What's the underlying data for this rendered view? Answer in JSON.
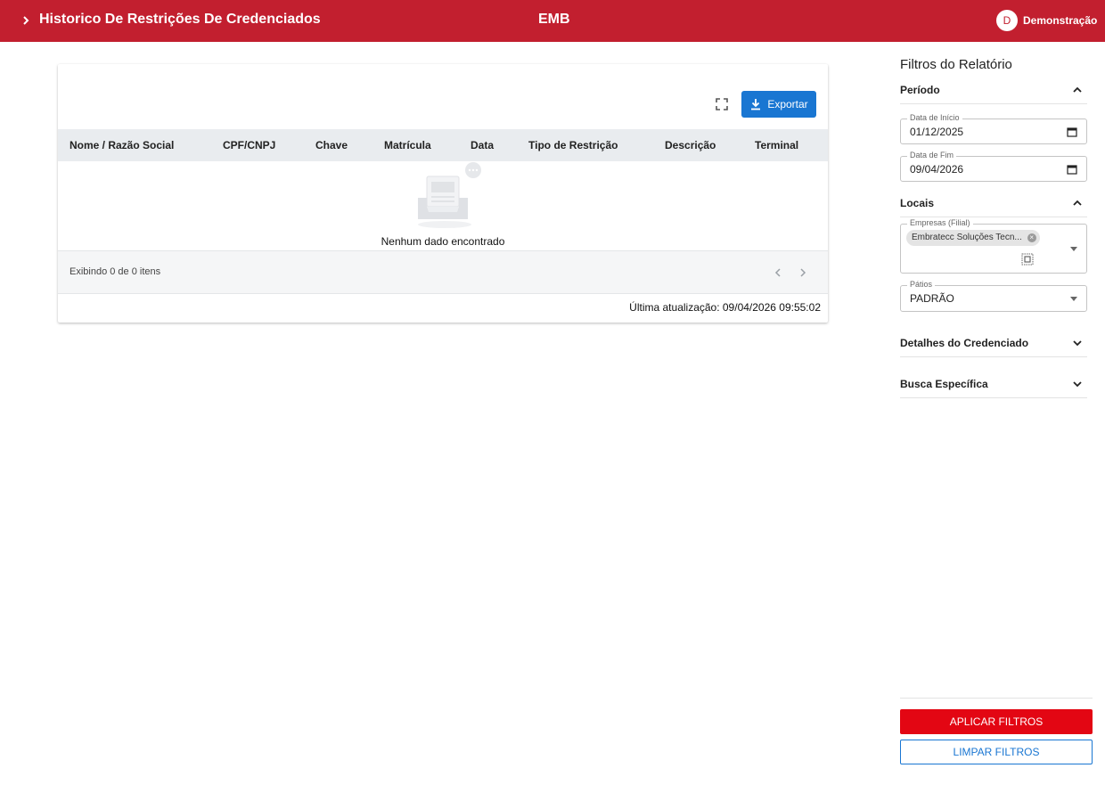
{
  "header": {
    "title": "Historico De Restrições De Credenciados",
    "center": "EMB",
    "avatar_initial": "D",
    "user_name": "Demonstração"
  },
  "toolbar": {
    "export_label": "Exportar"
  },
  "table": {
    "columns": [
      "Nome / Razão Social",
      "CPF/CNPJ",
      "Chave",
      "Matrícula",
      "Data",
      "Tipo de Restrição",
      "Descrição",
      "Terminal"
    ],
    "empty_message": "Nenhum dado encontrado",
    "footer_count": "Exibindo 0 de 0 itens",
    "last_update": "Última atualização: 09/04/2026 09:55:02"
  },
  "sidebar": {
    "title": "Filtros do Relatório",
    "periodo": {
      "label": "Período",
      "data_inicio_label": "Data de Início",
      "data_inicio_value": "01/12/2025",
      "data_fim_label": "Data de Fim",
      "data_fim_value": "09/04/2026"
    },
    "locais": {
      "label": "Locais",
      "empresas_label": "Empresas (Filial)",
      "empresas_chip": "Embratecc Soluções Tecn...",
      "patios_label": "Pátios",
      "patios_value": "PADRÃO"
    },
    "detalhes_label": "Detalhes do Credenciado",
    "busca_label": "Busca Específica",
    "apply_label": "APLICAR FILTROS",
    "clear_label": "LIMPAR FILTROS"
  },
  "colors": {
    "header_bg": "#c21f2f",
    "primary": "#1976d2",
    "apply_bg": "#e30613"
  }
}
